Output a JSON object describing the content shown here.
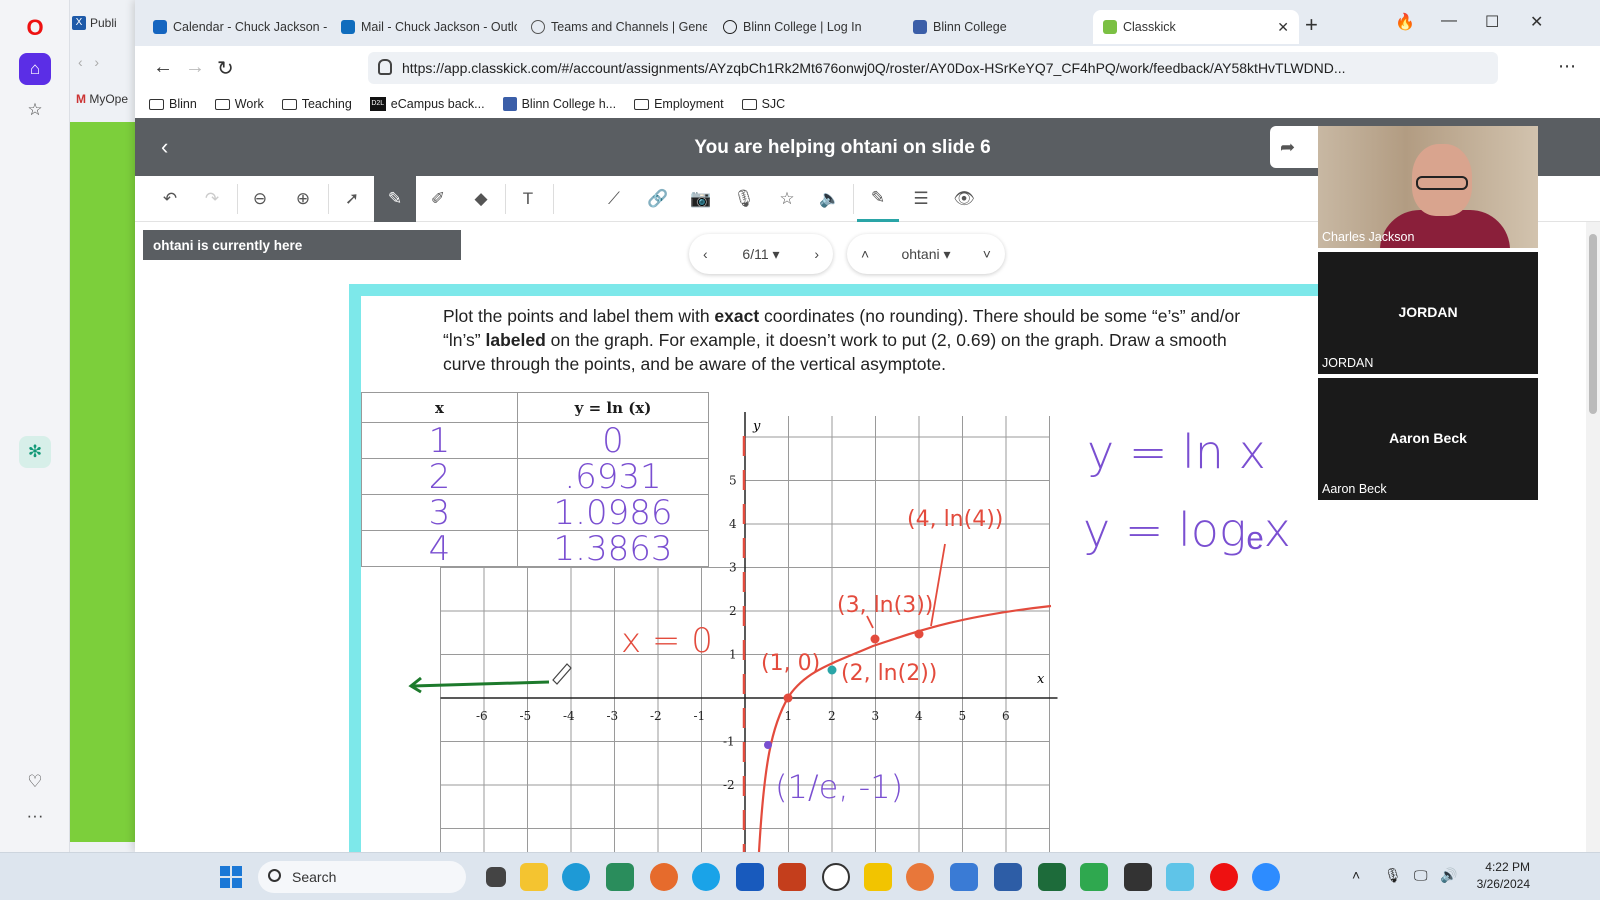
{
  "opera_sidebar": {
    "icons": [
      "opera-logo-icon",
      "home-icon",
      "star-icon",
      "chatgpt-icon",
      "heart-icon",
      "more-icon"
    ]
  },
  "bg_browser": {
    "tab_label": "Publi",
    "bookmark_label": "MyOpe"
  },
  "tabs": [
    {
      "label": "Calendar - Chuck Jackson - O",
      "icon": "calendar-icon",
      "color": "#1565c0"
    },
    {
      "label": "Mail - Chuck Jackson - Outlo",
      "icon": "outlook-icon",
      "color": "#0f6cbd"
    },
    {
      "label": "Teams and Channels | Gener",
      "icon": "globe-icon",
      "color": "#555555"
    },
    {
      "label": "Blinn College | Log In",
      "icon": "blinn-icon",
      "color": "#222222"
    },
    {
      "label": "Blinn College",
      "icon": "blinn-icon",
      "color": "#3b5ea8"
    },
    {
      "label": "Classkick",
      "icon": "classkick-icon",
      "color": "#7bc043",
      "active": true
    }
  ],
  "address": {
    "url": "https://app.classkick.com/#/account/assignments/AYzqbCh1Rk2Mt676onwj0Q/roster/AY0Dox-HSrKeYQ7_CF4hPQ/work/feedback/AY58ktHvTLWDND..."
  },
  "bookmarks": [
    {
      "label": "Blinn",
      "icon": "folder-icon"
    },
    {
      "label": "Work",
      "icon": "folder-icon"
    },
    {
      "label": "Teaching",
      "icon": "folder-icon"
    },
    {
      "label": "eCampus back...",
      "icon": "d2l-icon"
    },
    {
      "label": "Blinn College h...",
      "icon": "blinn-icon"
    },
    {
      "label": "Employment",
      "icon": "folder-icon"
    },
    {
      "label": "SJC",
      "icon": "folder-icon"
    }
  ],
  "app": {
    "title": "You are helping ohtani on slide 6",
    "banner": "ohtani is currently here",
    "slide_pager": "6/11",
    "student_pager": "ohtani",
    "toolbar_icons": [
      "undo-icon",
      "redo-icon",
      "zoom-out-icon",
      "zoom-in-icon",
      "select-icon",
      "pen-icon",
      "highlighter-icon",
      "eraser-icon",
      "text-icon",
      "line-icon",
      "link-icon",
      "camera-icon",
      "microphone-icon",
      "sticker-icon",
      "audio-icon",
      "color-pen-icon",
      "line-weight-icon",
      "eye-icon"
    ]
  },
  "slide": {
    "instructions": {
      "part1": "Plot the points and label them with ",
      "bold1": "exact",
      "part2": " coordinates (no rounding). There should be some “e’s” and/or “ln’s” ",
      "bold2": "labeled",
      "part3": " on the graph. For example, it doesn’t work to put (2, 0.69) on the graph. Draw a smooth curve through the points, and be aware of the vertical asymptote."
    },
    "table": {
      "headers": [
        "x",
        "y = ln (x)"
      ],
      "rows": [
        [
          "1",
          "0"
        ],
        [
          "2",
          ".6931"
        ],
        [
          "3",
          "1.0986"
        ],
        [
          "4",
          "1.3863"
        ]
      ]
    },
    "graph": {
      "x_label": "x",
      "y_label": "y",
      "x_ticks": [
        "-6",
        "-5",
        "-4",
        "-3",
        "-2",
        "-1",
        "1",
        "2",
        "3",
        "4",
        "5",
        "6"
      ],
      "y_ticks": [
        "5",
        "4",
        "3",
        "2",
        "1",
        "-1",
        "-2"
      ]
    },
    "annotations": {
      "asymptote": "x = 0",
      "p1": "(1, 0)",
      "p2": "(2, ln(2))",
      "p3": "(3, ln(3))",
      "p4": "(4, ln(4))",
      "p_e": "(1/e, -1)",
      "eq1": "y = ln x",
      "eq2": "y = logₑx"
    }
  },
  "zoom": [
    {
      "name": "Charles Jackson",
      "video": true
    },
    {
      "name": "JORDAN",
      "center": "JORDAN"
    },
    {
      "name": "Aaron Beck",
      "center": "Aaron Beck"
    }
  ],
  "taskbar": {
    "search_placeholder": "Search",
    "time": "4:22 PM",
    "date": "3/26/2024"
  }
}
